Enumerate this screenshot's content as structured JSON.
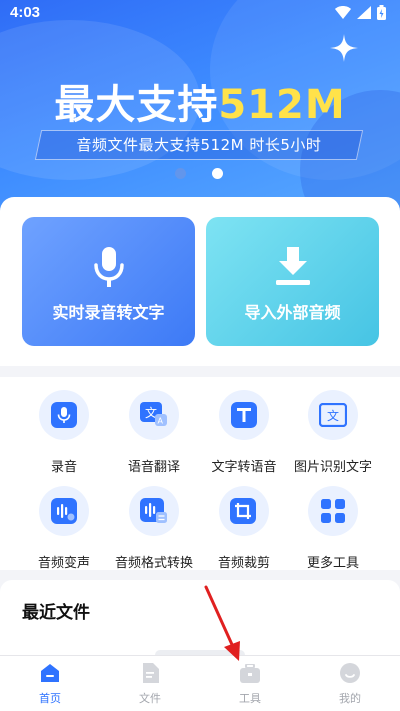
{
  "status_bar": {
    "time": "4:03"
  },
  "hero": {
    "title_main": "最大支持",
    "title_accent": "512M",
    "subtitle": "音频文件最大支持512M 时长5小时",
    "accent_color": "#ffe24a"
  },
  "primary_actions": [
    {
      "label": "实时录音转文字",
      "icon": "microphone-icon"
    },
    {
      "label": "导入外部音频",
      "icon": "download-icon"
    }
  ],
  "tools": [
    {
      "label": "录音",
      "icon": "microphone-icon"
    },
    {
      "label": "语音翻译",
      "icon": "translate-icon"
    },
    {
      "label": "文字转语音",
      "icon": "text-to-speech-icon"
    },
    {
      "label": "图片识别文字",
      "icon": "image-ocr-icon"
    },
    {
      "label": "音频变声",
      "icon": "voice-change-icon"
    },
    {
      "label": "音频格式转换",
      "icon": "format-convert-icon"
    },
    {
      "label": "音频裁剪",
      "icon": "crop-icon"
    },
    {
      "label": "更多工具",
      "icon": "more-tools-icon"
    }
  ],
  "recent": {
    "title": "最近文件"
  },
  "bottom_nav": [
    {
      "label": "首页",
      "icon": "home-icon",
      "active": true
    },
    {
      "label": "文件",
      "icon": "file-icon",
      "active": false
    },
    {
      "label": "工具",
      "icon": "toolbox-icon",
      "active": false
    },
    {
      "label": "我的",
      "icon": "profile-icon",
      "active": false
    }
  ],
  "colors": {
    "primary": "#2f73ff",
    "tool_icon_bg": "#eaf1ff",
    "annotation_arrow": "#e02020"
  }
}
